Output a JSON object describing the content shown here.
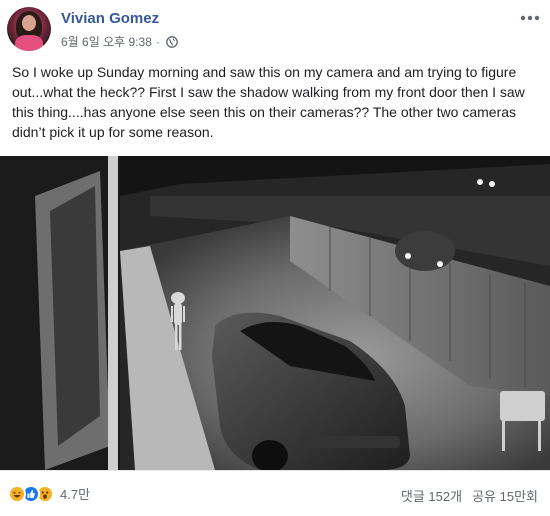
{
  "post": {
    "author": "Vivian Gomez",
    "timestamp": "6월 6일 오후 9:38",
    "separator": "·",
    "privacy_icon": "globe-icon",
    "more_icon": "more-options-icon",
    "text": "So I woke up Sunday morning and saw this on my camera and am trying to figure out...what the heck?? First I saw the shadow walking from my front door then I saw this thing....has anyone else seen this on their cameras?? The other two cameras didn’t pick it up for some reason."
  },
  "reactions": {
    "icons": [
      "haha-reaction-icon",
      "like-reaction-icon",
      "wow-reaction-icon"
    ],
    "count": "4.7만"
  },
  "stats": {
    "comments": "댓글 152개",
    "shares": "공유 15만회"
  },
  "colors": {
    "author_link": "#385898",
    "secondary_text": "#606770",
    "like_blue": "#1877f2",
    "emoji_yellow": "#f7b125"
  }
}
